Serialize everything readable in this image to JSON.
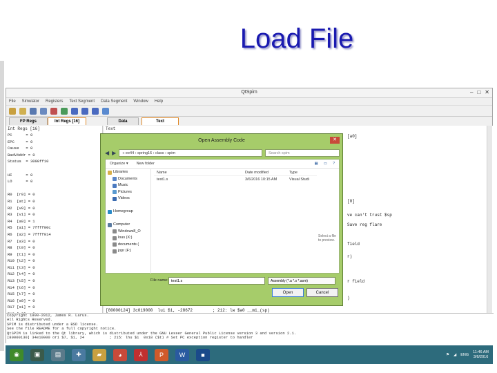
{
  "slide": {
    "title": "Load File"
  },
  "app": {
    "title": "QtSpim",
    "menu": [
      "File",
      "Simulator",
      "Registers",
      "Text Segment",
      "Data Segment",
      "Window",
      "Help"
    ],
    "tabs": {
      "fp_regs": "FP Regs",
      "int_regs": "Int Regs [16]",
      "data": "Data",
      "text": "Text"
    },
    "int_pane_label": "Int Regs [16]",
    "text_pane_label": "Text",
    "registers": [
      "PC      = 0",
      "EPC     = 0",
      "Cause   = 0",
      "BadVAddr = 0",
      "Status  = 3000ff10",
      "",
      "HI      = 0",
      "LO      = 0",
      "",
      "R0  [r0] = 0",
      "R1  [at] = 0",
      "R2  [v0] = 0",
      "R3  [v1] = 0",
      "R4  [a0] = 1",
      "R5  [a1] = 7ffff00c",
      "R6  [a2] = 7ffff014",
      "R7  [a3] = 0",
      "R8  [t0] = 0",
      "R9  [t1] = 0",
      "R10 [t2] = 0",
      "R11 [t3] = 0",
      "R12 [t4] = 0",
      "R13 [t5] = 0",
      "R14 [t6] = 0",
      "R15 [t7] = 0",
      "R16 [s0] = 0",
      "R17 [s1] = 0",
      "R18 [s2] = 0",
      "R19 [s3] = 0",
      "R20 [s4] = 0",
      "R21 [s5] = 0",
      "R22 [s6] = 0",
      "R23 [s7] = 0",
      "R24 [t8] = 0",
      "R27 [k1] = 0"
    ],
    "text_fragments": [
      "[a0]",
      "[0]",
      "ve can't trust $sp",
      "Save reg flare",
      "field",
      "r)",
      "r field",
      ")",
      "[80000124] 3c019000  lui $1, -28672        ; 212: lw $a0 __m1_(sp)"
    ],
    "log": [
      "Copyright 1990-2012, James R. Larus.",
      "All Rights Reserved.",
      "SPIM is distributed under a BSD license.",
      "See the file README for a full copyright notice.",
      "QtSPIM is linked to the Qt library, which is distributed under the GNU Lesser General Public License version 3 and version 2.1.",
      "[80000130] 34e10000 ori $7, $1, 24           ; 215: lhu $1  0x18 ($t) # Set PC exception register to handler"
    ]
  },
  "dialog": {
    "title": "Open Assembly Code",
    "close": "✕",
    "path": "« ee44 › spring16 › class › spim",
    "search_placeholder": "Search spim",
    "organize": "Organize ▾",
    "new_folder": "New folder",
    "tree": [
      {
        "label": "Libraries",
        "icon": "libraries-icon",
        "color": "#d8b04a"
      },
      {
        "label": "Documents",
        "icon": "documents-icon",
        "color": "#5a86c8"
      },
      {
        "label": "Music",
        "icon": "music-icon",
        "color": "#4a7ac0"
      },
      {
        "label": "Pictures",
        "icon": "pictures-icon",
        "color": "#5a9ad0"
      },
      {
        "label": "Videos",
        "icon": "videos-icon",
        "color": "#3a6ab0"
      },
      {
        "label": "",
        "icon": "",
        "color": ""
      },
      {
        "label": "Homegroup",
        "icon": "homegroup-icon",
        "color": "#2a8ac8"
      },
      {
        "label": "",
        "icon": "",
        "color": ""
      },
      {
        "label": "Computer",
        "icon": "computer-icon",
        "color": "#5a7aa0"
      },
      {
        "label": "Windows8_O",
        "icon": "drive-icon",
        "color": "#8a8a8a"
      },
      {
        "label": "lous (X:)",
        "icon": "drive-icon",
        "color": "#8a8a8a"
      },
      {
        "label": "documents (",
        "icon": "drive-icon",
        "color": "#8a8a8a"
      },
      {
        "label": "jopr (F:)",
        "icon": "drive-icon",
        "color": "#8a8a8a"
      }
    ],
    "columns": {
      "name": "Name",
      "date": "Date modified",
      "type": "Type"
    },
    "files": [
      {
        "name": "test1.s",
        "date": "3/6/2016 10:15 AM",
        "type": "Visual Studi"
      }
    ],
    "preview_text": "Select a file to preview.",
    "file_name_label": "File name:",
    "file_name_value": "test1.s",
    "file_type_value": "Assembly (*.a *.s *.asm)",
    "open_label": "Open",
    "cancel_label": "Cancel",
    "accent": "#a6cc6a"
  },
  "taskbar": {
    "apps": [
      {
        "icon": "start-icon",
        "color": "#3f8a2a",
        "glyph": "◉"
      },
      {
        "icon": "monitor-icon",
        "color": "#3a5a4a",
        "glyph": "▣"
      },
      {
        "icon": "computer-icon",
        "color": "#5a7a8a",
        "glyph": "▤"
      },
      {
        "icon": "network-icon",
        "color": "#4a7aa0",
        "glyph": "✚"
      },
      {
        "icon": "folder-icon",
        "color": "#c8a040",
        "glyph": "▰"
      },
      {
        "icon": "chrome-icon",
        "color": "#c84a3a",
        "glyph": "◕"
      },
      {
        "icon": "pdf-icon",
        "color": "#c03030",
        "glyph": "⅄"
      },
      {
        "icon": "powerpoint-icon",
        "color": "#d05a2a",
        "glyph": "P"
      },
      {
        "icon": "word-icon",
        "color": "#2a5aa0",
        "glyph": "W"
      },
      {
        "icon": "qtspim-icon",
        "color": "#1a4a8a",
        "glyph": "■"
      }
    ],
    "lang": "ENG",
    "time": "11:46 AM",
    "date": "3/6/2016"
  }
}
